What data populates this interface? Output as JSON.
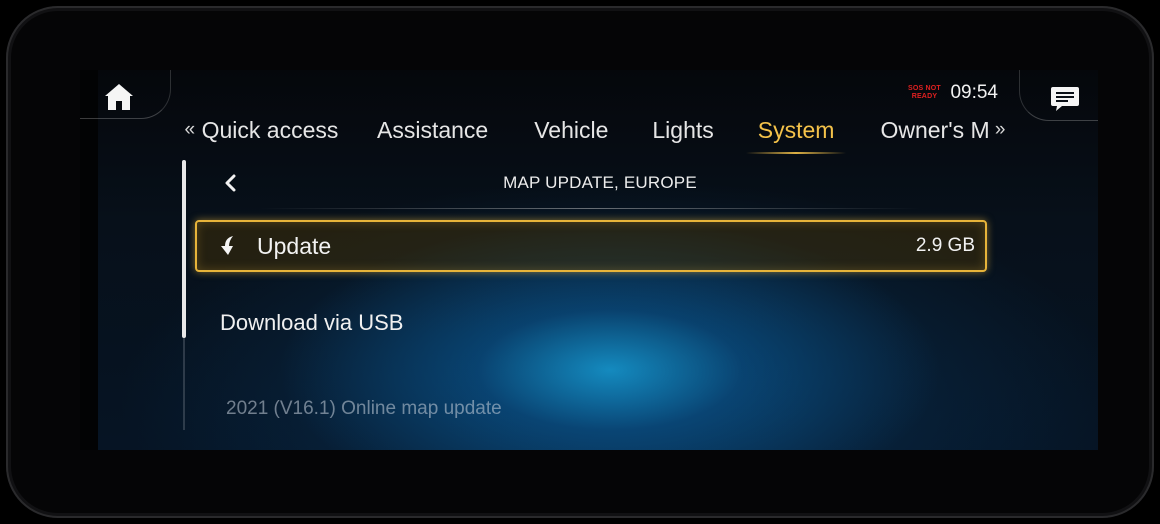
{
  "status": {
    "sos_line1": "SOS NOT",
    "sos_line2": "READY",
    "time": "09:54"
  },
  "tabs": {
    "prev_arrow": "«",
    "next_arrow": "»",
    "items": [
      {
        "label": "Quick access"
      },
      {
        "label": "Assistance"
      },
      {
        "label": "Vehicle"
      },
      {
        "label": "Lights"
      },
      {
        "label": "System",
        "active": true
      },
      {
        "label": "Owner's Ma"
      }
    ]
  },
  "page": {
    "back_label": "‹",
    "title": "MAP UPDATE, EUROPE"
  },
  "rows": {
    "update": {
      "label": "Update",
      "value": "2.9 GB",
      "icon": "download-cloud-icon"
    },
    "usb": {
      "label": "Download via USB"
    }
  },
  "footer_note": "2021 (V16.1) Online map update",
  "colors": {
    "accent": "#f4c24a",
    "highlight_border": "#e7b43a",
    "sos_red": "#e02020"
  }
}
